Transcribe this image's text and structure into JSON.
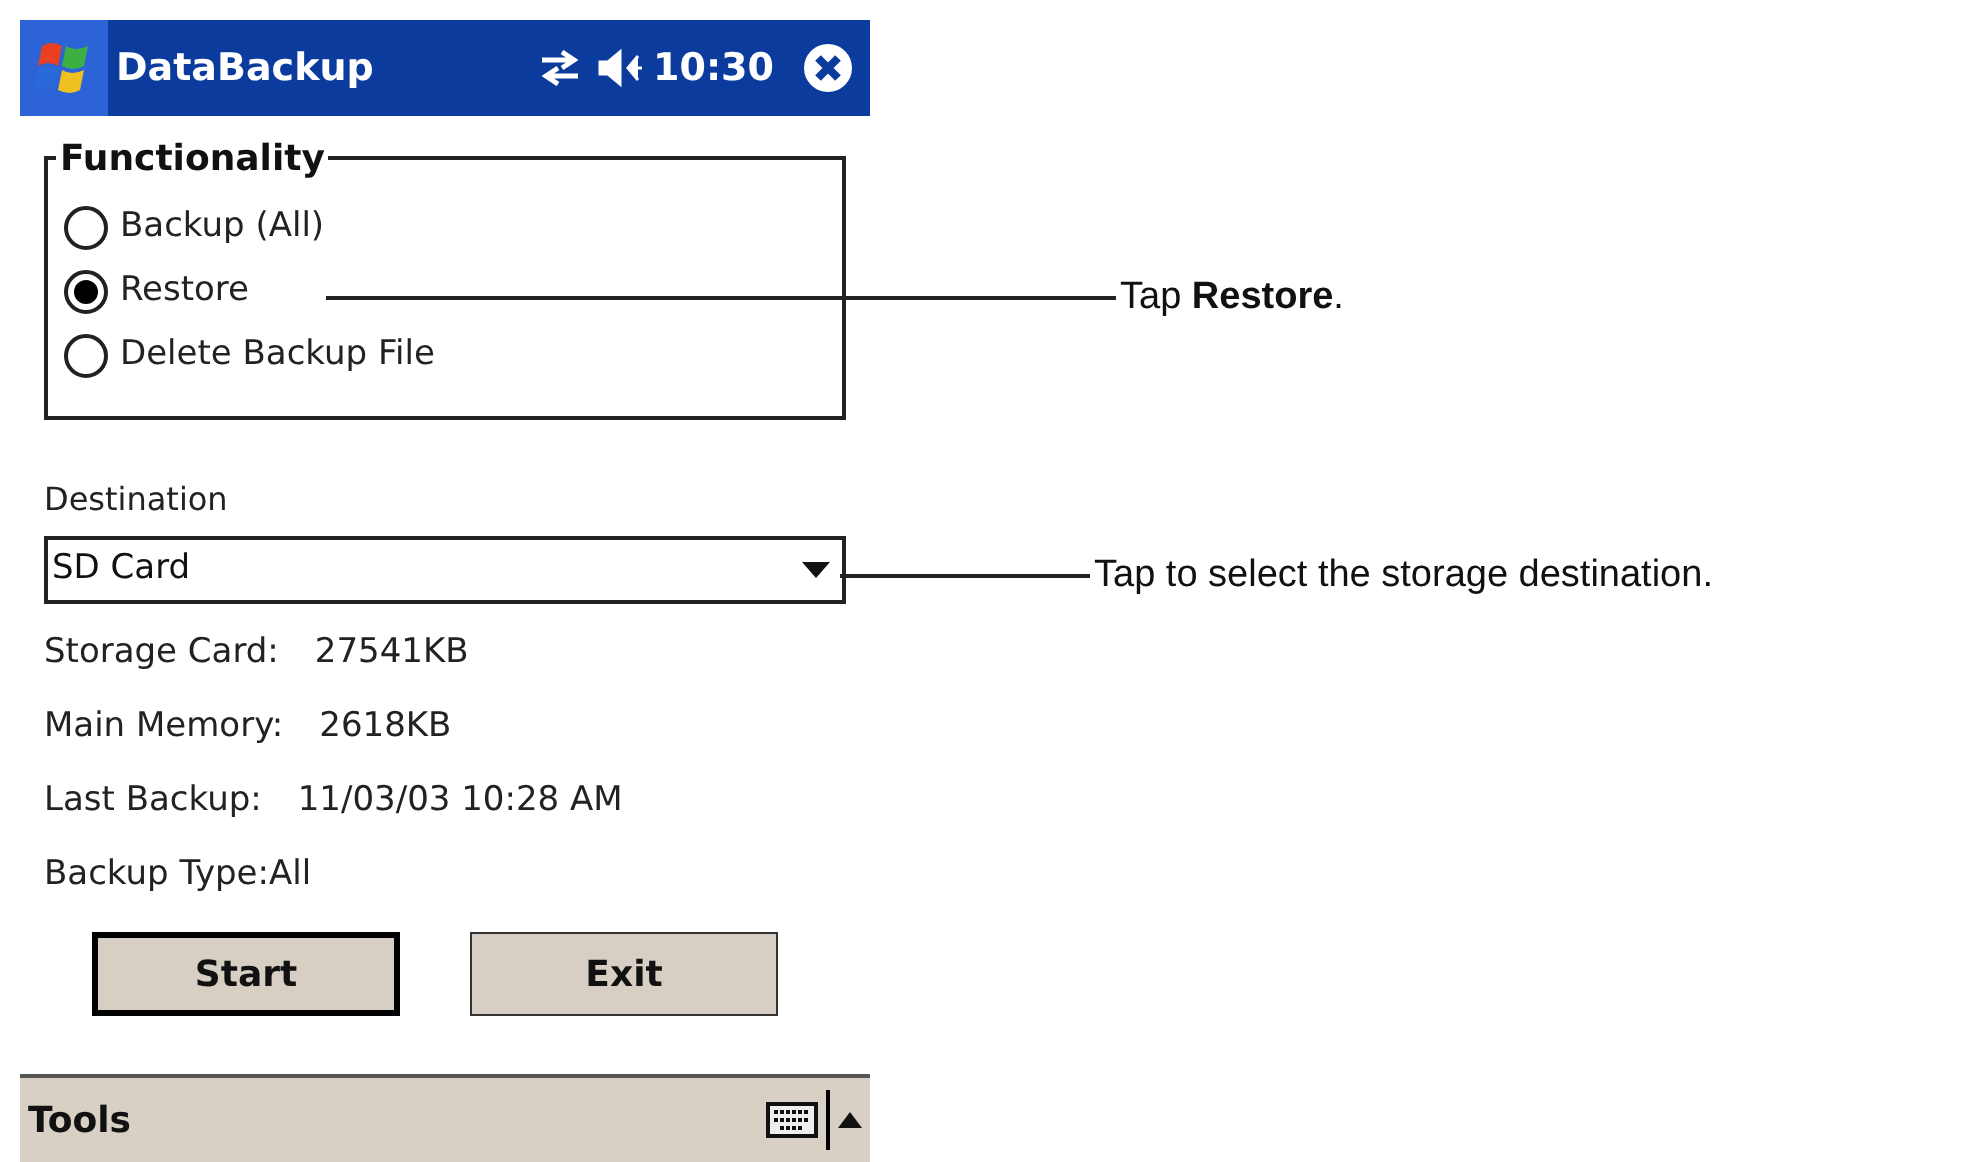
{
  "title_bar": {
    "title": "DataBackup",
    "time": "10:30"
  },
  "functionality": {
    "label": "Functionality",
    "options": [
      {
        "label": "Backup (All)",
        "selected": false
      },
      {
        "label": "Restore",
        "selected": true
      },
      {
        "label": "Delete Backup File",
        "selected": false
      }
    ]
  },
  "destination": {
    "label": "Destination",
    "value": "SD Card"
  },
  "info": [
    {
      "label": "Storage Card:",
      "value": "27541KB"
    },
    {
      "label": "Main Memory:",
      "value": "2618KB"
    },
    {
      "label": "Last Backup:",
      "value": "11/03/03 10:28 AM"
    },
    {
      "label": "Backup Type:All"
    }
  ],
  "buttons": [
    {
      "label": "Start",
      "default": true
    },
    {
      "label": "Exit",
      "default": false
    }
  ],
  "menu_bar": {
    "items": [
      "Tools"
    ]
  },
  "callouts": [
    {
      "text": "Tap **Restore**."
    },
    {
      "text": "Tap to select the storage destination."
    }
  ]
}
